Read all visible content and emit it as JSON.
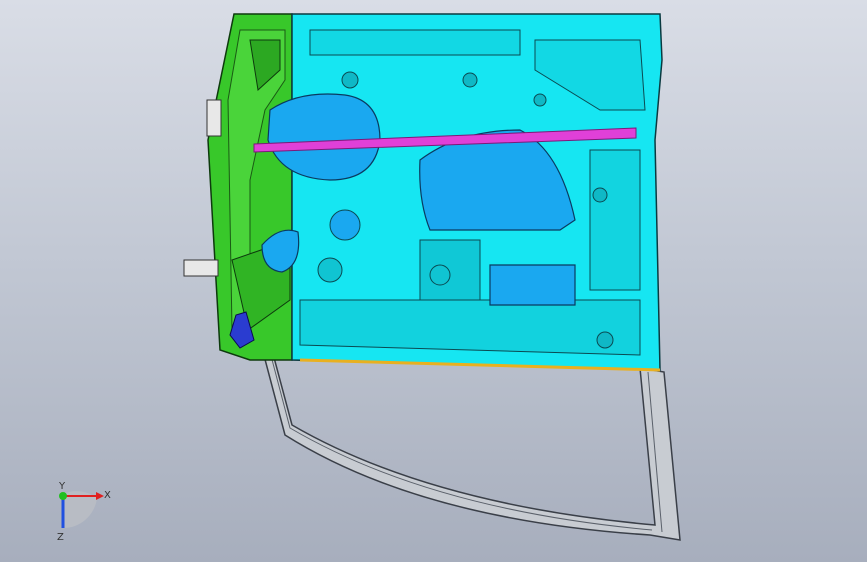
{
  "viewport": {
    "background_top": "#d9dde6",
    "background_bottom": "#a7aebd"
  },
  "model": {
    "inner_panel_color": "#16e6f2",
    "hinge_region_color": "#38c82a",
    "opening_color": "#1aa8f0",
    "impact_beam_color": "#e040d8",
    "frame_color": "#c8ccd2",
    "latch_color": "#2a3cd0",
    "hinge_part_color": "#e8e8e8"
  },
  "triad": {
    "x_label": "X",
    "y_label": "Y",
    "z_label": "Z",
    "x_color": "#e02020",
    "y_color": "#20c020",
    "z_color": "#2050e0"
  }
}
